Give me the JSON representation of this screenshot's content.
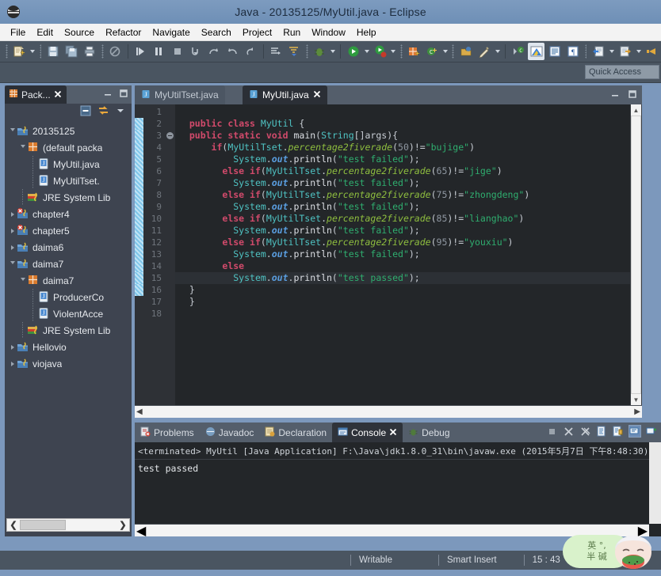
{
  "window": {
    "title": "Java - 20135125/MyUtil.java - Eclipse",
    "app_icon": "eclipse-icon"
  },
  "menubar": {
    "items": [
      {
        "label": "File",
        "name": "menu-file"
      },
      {
        "label": "Edit",
        "name": "menu-edit"
      },
      {
        "label": "Source",
        "name": "menu-source"
      },
      {
        "label": "Refactor",
        "name": "menu-refactor"
      },
      {
        "label": "Navigate",
        "name": "menu-navigate"
      },
      {
        "label": "Search",
        "name": "menu-search"
      },
      {
        "label": "Project",
        "name": "menu-project"
      },
      {
        "label": "Run",
        "name": "menu-run"
      },
      {
        "label": "Window",
        "name": "menu-window"
      },
      {
        "label": "Help",
        "name": "menu-help"
      }
    ]
  },
  "toolbar": {
    "buttons": [
      "new-wizard-icon",
      "dropdown-arrow",
      "save-icon",
      "save-all-icon",
      "print-icon",
      "separator",
      "quick-toggle-icon",
      "separator",
      "resume-icon",
      "suspend-icon",
      "terminate-icon",
      "step-into-icon",
      "step-over-icon",
      "step-return-icon",
      "drop-to-frame-icon",
      "separator",
      "next-annotation-icon",
      "previous-annotation-icon",
      "separator",
      "debug-icon",
      "dropdown-arrow",
      "separator",
      "run-icon",
      "dropdown-arrow",
      "run-last-icon",
      "dropdown-arrow",
      "separator",
      "new-java-project-icon",
      "new-class-icon",
      "dropdown-arrow",
      "separator",
      "open-type-icon",
      "search-icon",
      "dropdown-arrow",
      "separator",
      "coverage-icon",
      "java-perspective-icon",
      "outline-icon",
      "task-icon",
      "separator",
      "export-icon",
      "dropdown-arrow",
      "import-icon",
      "dropdown-arrow",
      "back-icon"
    ]
  },
  "quick_access": {
    "placeholder": "Quick Access",
    "value": "Quick Access"
  },
  "package_explorer": {
    "tab_label": "Pack...",
    "tab_icon": "package-explorer-icon",
    "close_icon": "close-icon",
    "minimize_icon": "minimize-icon",
    "maximize_icon": "maximize-icon",
    "collapse_all_icon": "collapse-all-icon",
    "link_with_editor_icon": "link-editor-icon",
    "view_menu_icon": "view-menu-icon",
    "tree": [
      {
        "label": "20135125",
        "indent": 0,
        "icon": "java-project-icon",
        "state": "expanded"
      },
      {
        "label": "(default packa",
        "indent": 1,
        "icon": "package-icon",
        "state": "expanded"
      },
      {
        "label": "MyUtil.java",
        "indent": 2,
        "icon": "java-file-icon",
        "state": "leaf"
      },
      {
        "label": "MyUtilTset.",
        "indent": 2,
        "icon": "java-file-icon",
        "state": "leaf"
      },
      {
        "label": "JRE System Lib",
        "indent": 1,
        "icon": "jre-library-icon",
        "state": "leaf"
      },
      {
        "label": "chapter4",
        "indent": 0,
        "icon": "java-project-error-icon",
        "state": "collapsed"
      },
      {
        "label": "chapter5",
        "indent": 0,
        "icon": "java-project-error-icon",
        "state": "collapsed"
      },
      {
        "label": "daima6",
        "indent": 0,
        "icon": "java-project-icon",
        "state": "collapsed"
      },
      {
        "label": "daima7",
        "indent": 0,
        "icon": "java-project-icon",
        "state": "expanded"
      },
      {
        "label": "daima7",
        "indent": 1,
        "icon": "package-icon",
        "state": "expanded"
      },
      {
        "label": "ProducerCo",
        "indent": 2,
        "icon": "java-file-icon",
        "state": "leaf"
      },
      {
        "label": "ViolentAcce",
        "indent": 2,
        "icon": "java-file-icon",
        "state": "leaf"
      },
      {
        "label": "JRE System Lib",
        "indent": 1,
        "icon": "jre-library-icon",
        "state": "leaf"
      },
      {
        "label": "Hellovio",
        "indent": 0,
        "icon": "java-project-icon",
        "state": "collapsed"
      },
      {
        "label": "viojava",
        "indent": 0,
        "icon": "java-project-icon",
        "state": "collapsed"
      }
    ]
  },
  "editor": {
    "tabs": [
      {
        "label": "MyUtilTset.java",
        "active": false,
        "icon": "java-file-icon",
        "closable": false
      },
      {
        "label": "MyUtil.java",
        "active": true,
        "icon": "java-file-icon",
        "closable": true
      }
    ],
    "minimize_icon": "minimize-icon",
    "maximize_icon": "maximize-icon",
    "first_line": 1,
    "last_line": 18,
    "current_line": 15,
    "lines": [
      {
        "n": 1,
        "tokens": []
      },
      {
        "n": 2,
        "tokens": [
          {
            "t": "pad",
            "v": "  "
          },
          {
            "t": "kw",
            "v": "public"
          },
          {
            "t": "pun",
            "v": " "
          },
          {
            "t": "kw",
            "v": "class"
          },
          {
            "t": "pun",
            "v": " "
          },
          {
            "t": "cls",
            "v": "MyUtil"
          },
          {
            "t": "pun",
            "v": " {"
          }
        ]
      },
      {
        "n": 3,
        "fold": true,
        "tokens": [
          {
            "t": "pad",
            "v": "  "
          },
          {
            "t": "kw",
            "v": "public"
          },
          {
            "t": "pun",
            "v": " "
          },
          {
            "t": "kw",
            "v": "static"
          },
          {
            "t": "pun",
            "v": " "
          },
          {
            "t": "kw",
            "v": "void"
          },
          {
            "t": "pun",
            "v": " "
          },
          {
            "t": "mcall",
            "v": "main"
          },
          {
            "t": "pun",
            "v": "("
          },
          {
            "t": "cls",
            "v": "String"
          },
          {
            "t": "pun",
            "v": "[]args){"
          }
        ]
      },
      {
        "n": 4,
        "tokens": [
          {
            "t": "pad",
            "v": "      "
          },
          {
            "t": "kw",
            "v": "if"
          },
          {
            "t": "pun",
            "v": "("
          },
          {
            "t": "cls",
            "v": "MyUtilTset"
          },
          {
            "t": "pun",
            "v": "."
          },
          {
            "t": "mth",
            "v": "percentage2fiverade"
          },
          {
            "t": "pun",
            "v": "("
          },
          {
            "t": "num",
            "v": "50"
          },
          {
            "t": "pun",
            "v": ")!="
          },
          {
            "t": "str",
            "v": "\"bujige\""
          },
          {
            "t": "pun",
            "v": ")"
          }
        ]
      },
      {
        "n": 5,
        "tokens": [
          {
            "t": "pad",
            "v": "          "
          },
          {
            "t": "cls",
            "v": "System"
          },
          {
            "t": "pun",
            "v": "."
          },
          {
            "t": "sfld",
            "v": "out"
          },
          {
            "t": "pun",
            "v": "."
          },
          {
            "t": "mcall",
            "v": "println"
          },
          {
            "t": "pun",
            "v": "("
          },
          {
            "t": "str",
            "v": "\"test failed\""
          },
          {
            "t": "pun",
            "v": ");"
          }
        ]
      },
      {
        "n": 6,
        "tokens": [
          {
            "t": "pad",
            "v": "        "
          },
          {
            "t": "kw",
            "v": "else"
          },
          {
            "t": "pun",
            "v": " "
          },
          {
            "t": "kw",
            "v": "if"
          },
          {
            "t": "pun",
            "v": "("
          },
          {
            "t": "cls",
            "v": "MyUtilTset"
          },
          {
            "t": "pun",
            "v": "."
          },
          {
            "t": "mth",
            "v": "percentage2fiverade"
          },
          {
            "t": "pun",
            "v": "("
          },
          {
            "t": "num",
            "v": "65"
          },
          {
            "t": "pun",
            "v": ")!="
          },
          {
            "t": "str",
            "v": "\"jige\""
          },
          {
            "t": "pun",
            "v": ")"
          }
        ]
      },
      {
        "n": 7,
        "tokens": [
          {
            "t": "pad",
            "v": "          "
          },
          {
            "t": "cls",
            "v": "System"
          },
          {
            "t": "pun",
            "v": "."
          },
          {
            "t": "sfld",
            "v": "out"
          },
          {
            "t": "pun",
            "v": "."
          },
          {
            "t": "mcall",
            "v": "println"
          },
          {
            "t": "pun",
            "v": "("
          },
          {
            "t": "str",
            "v": "\"test failed\""
          },
          {
            "t": "pun",
            "v": ");"
          }
        ]
      },
      {
        "n": 8,
        "tokens": [
          {
            "t": "pad",
            "v": "        "
          },
          {
            "t": "kw",
            "v": "else"
          },
          {
            "t": "pun",
            "v": " "
          },
          {
            "t": "kw",
            "v": "if"
          },
          {
            "t": "pun",
            "v": "("
          },
          {
            "t": "cls",
            "v": "MyUtilTset"
          },
          {
            "t": "pun",
            "v": "."
          },
          {
            "t": "mth",
            "v": "percentage2fiverade"
          },
          {
            "t": "pun",
            "v": "("
          },
          {
            "t": "num",
            "v": "75"
          },
          {
            "t": "pun",
            "v": ")!="
          },
          {
            "t": "str",
            "v": "\"zhongdeng\""
          },
          {
            "t": "pun",
            "v": ")"
          }
        ]
      },
      {
        "n": 9,
        "tokens": [
          {
            "t": "pad",
            "v": "          "
          },
          {
            "t": "cls",
            "v": "System"
          },
          {
            "t": "pun",
            "v": "."
          },
          {
            "t": "sfld",
            "v": "out"
          },
          {
            "t": "pun",
            "v": "."
          },
          {
            "t": "mcall",
            "v": "println"
          },
          {
            "t": "pun",
            "v": "("
          },
          {
            "t": "str",
            "v": "\"test failed\""
          },
          {
            "t": "pun",
            "v": ");"
          }
        ]
      },
      {
        "n": 10,
        "tokens": [
          {
            "t": "pad",
            "v": "        "
          },
          {
            "t": "kw",
            "v": "else"
          },
          {
            "t": "pun",
            "v": " "
          },
          {
            "t": "kw",
            "v": "if"
          },
          {
            "t": "pun",
            "v": "("
          },
          {
            "t": "cls",
            "v": "MyUtilTset"
          },
          {
            "t": "pun",
            "v": "."
          },
          {
            "t": "mth",
            "v": "percentage2fiverade"
          },
          {
            "t": "pun",
            "v": "("
          },
          {
            "t": "num",
            "v": "85"
          },
          {
            "t": "pun",
            "v": ")!="
          },
          {
            "t": "str",
            "v": "\"lianghao\""
          },
          {
            "t": "pun",
            "v": ")"
          }
        ]
      },
      {
        "n": 11,
        "tokens": [
          {
            "t": "pad",
            "v": "          "
          },
          {
            "t": "cls",
            "v": "System"
          },
          {
            "t": "pun",
            "v": "."
          },
          {
            "t": "sfld",
            "v": "out"
          },
          {
            "t": "pun",
            "v": "."
          },
          {
            "t": "mcall",
            "v": "println"
          },
          {
            "t": "pun",
            "v": "("
          },
          {
            "t": "str",
            "v": "\"test failed\""
          },
          {
            "t": "pun",
            "v": ");"
          }
        ]
      },
      {
        "n": 12,
        "tokens": [
          {
            "t": "pad",
            "v": "        "
          },
          {
            "t": "kw",
            "v": "else"
          },
          {
            "t": "pun",
            "v": " "
          },
          {
            "t": "kw",
            "v": "if"
          },
          {
            "t": "pun",
            "v": "("
          },
          {
            "t": "cls",
            "v": "MyUtilTset"
          },
          {
            "t": "pun",
            "v": "."
          },
          {
            "t": "mth",
            "v": "percentage2fiverade"
          },
          {
            "t": "pun",
            "v": "("
          },
          {
            "t": "num",
            "v": "95"
          },
          {
            "t": "pun",
            "v": ")!="
          },
          {
            "t": "str",
            "v": "\"youxiu\""
          },
          {
            "t": "pun",
            "v": ")"
          }
        ]
      },
      {
        "n": 13,
        "tokens": [
          {
            "t": "pad",
            "v": "          "
          },
          {
            "t": "cls",
            "v": "System"
          },
          {
            "t": "pun",
            "v": "."
          },
          {
            "t": "sfld",
            "v": "out"
          },
          {
            "t": "pun",
            "v": "."
          },
          {
            "t": "mcall",
            "v": "println"
          },
          {
            "t": "pun",
            "v": "("
          },
          {
            "t": "str",
            "v": "\"test failed\""
          },
          {
            "t": "pun",
            "v": ");"
          }
        ]
      },
      {
        "n": 14,
        "tokens": [
          {
            "t": "pad",
            "v": "        "
          },
          {
            "t": "kw",
            "v": "else"
          }
        ]
      },
      {
        "n": 15,
        "current": true,
        "tokens": [
          {
            "t": "pad",
            "v": "          "
          },
          {
            "t": "cls",
            "v": "System"
          },
          {
            "t": "pun",
            "v": "."
          },
          {
            "t": "sfld",
            "v": "out"
          },
          {
            "t": "pun",
            "v": "."
          },
          {
            "t": "mcall",
            "v": "println"
          },
          {
            "t": "pun",
            "v": "("
          },
          {
            "t": "str",
            "v": "\"test passed\""
          },
          {
            "t": "pun",
            "v": ");"
          }
        ]
      },
      {
        "n": 16,
        "tokens": [
          {
            "t": "pad",
            "v": "  "
          },
          {
            "t": "pun",
            "v": "}"
          }
        ]
      },
      {
        "n": 17,
        "tokens": [
          {
            "t": "pad",
            "v": "  "
          },
          {
            "t": "pun",
            "v": "}"
          }
        ]
      },
      {
        "n": 18,
        "tokens": []
      }
    ]
  },
  "console": {
    "tabs": [
      {
        "label": "Problems",
        "icon": "problems-icon",
        "active": false,
        "closable": false
      },
      {
        "label": "Javadoc",
        "icon": "javadoc-icon",
        "active": false,
        "closable": false
      },
      {
        "label": "Declaration",
        "icon": "declaration-icon",
        "active": false,
        "closable": false
      },
      {
        "label": "Console",
        "icon": "console-icon",
        "active": true,
        "closable": true
      },
      {
        "label": "Debug",
        "icon": "debug-icon",
        "active": false,
        "closable": false
      }
    ],
    "toolbar_icons": [
      "terminate-icon",
      "remove-launch-icon",
      "remove-all-launches-icon",
      "open-console-icon",
      "pin-console-icon",
      "display-console-icon",
      "new-console-icon"
    ],
    "header": "<terminated> MyUtil [Java Application] F:\\Java\\jdk1.8.0_31\\bin\\javaw.exe (2015年5月7日 下午8:48:30)",
    "output": "test passed"
  },
  "statusbar": {
    "writable": "Writable",
    "insert_mode": "Smart Insert",
    "cursor_position": "15 : 43"
  },
  "mascot": {
    "line1": "英 °,",
    "line2": "半 碱"
  },
  "colors": {
    "titlebar": "#7c98bc",
    "toolbar": "#4a5561",
    "editor_bg": "#232629",
    "panel_bg": "#3e4450",
    "keyword": "#d14a6b",
    "string": "#2fae6f",
    "class": "#4fc3c3",
    "method": "#8fbf3f",
    "field": "#5a9ee0",
    "accent": "#7c98bc"
  }
}
